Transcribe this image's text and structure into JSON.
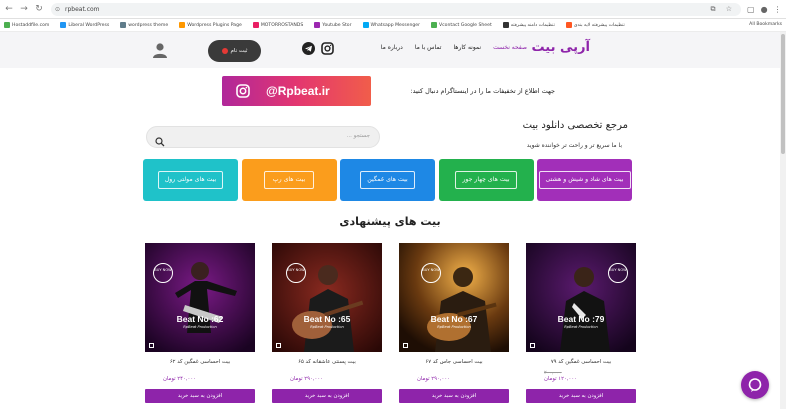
{
  "browser": {
    "url": "rpbeat.com",
    "bookmarks": [
      "Hostaddfile.com",
      "Liberal WordPress",
      "wordpress theme",
      "Wordpress Plugins Page",
      "MOTORROSTANDS",
      "Youtube Stor",
      "Whatsapp Messenger",
      "Vcontact Google Sheet",
      "تنظیمات دامنه پیشرفته",
      "تنظیمات پیشرفته لایه بندی",
      "All Bookmarks"
    ],
    "bookmark_colors": [
      "#4caf50",
      "#2196f3",
      "#607d8b",
      "#ff9800",
      "#e91e63",
      "#9c27b0",
      "#03a9f4",
      "#4caf50",
      "#333333",
      "#ff5722"
    ]
  },
  "header": {
    "logo": "آرپی بیت",
    "menu": [
      "صفحه نخست",
      "نمونه کارها",
      "تماس با ما",
      "درباره ما"
    ],
    "login_label": "ثبت نام",
    "accent": "#8e24aa"
  },
  "instagram": {
    "handle": "@Rpbeat.ir",
    "text": "جهت اطلاع از تخفیفات ما را در اینستاگرام دنبال کنید:"
  },
  "hero": {
    "title": "مرجع تخصصی دانلود بیت",
    "subtitle": "با ما سریع تر و راحت تر خواننده شوید",
    "search_placeholder": "جستجو ..."
  },
  "categories": [
    {
      "label": "بیت های شاد و شیش و هشتی",
      "color": "#a22fb9"
    },
    {
      "label": "بیت های چهار جور",
      "color": "#23b14d"
    },
    {
      "label": "بیت های غمگین",
      "color": "#1e88e5"
    },
    {
      "label": "بیت های رپ",
      "color": "#fb9d1c"
    },
    {
      "label": "بیت های مولتی رول",
      "color": "#1fc2c9"
    }
  ],
  "section_title": "بیت های پیشنهادی",
  "products": [
    {
      "beat": "Beat No :79",
      "sub": "RpBeat Production",
      "name": "بیت احساسی غمگین کد ۷۹",
      "old_price": "۲۰۰,۰۰۰",
      "price": "۱۲۰,۰۰۰ تومان",
      "buy": "افزودن به سبد خرید"
    },
    {
      "beat": "Beat No :67",
      "sub": "RpBeat Production",
      "name": "بیت احساسی جاس کد ۶۷",
      "old_price": "",
      "price": "۲۹۰,۰۰۰ تومان",
      "buy": "افزودن به سبد خرید"
    },
    {
      "beat": "Beat No :65",
      "sub": "RpBeat Production",
      "name": "بیت پسنتی عاشقانه کد ۶۵",
      "old_price": "",
      "price": "۲۹۰,۰۰۰ تومان",
      "buy": "افزودن به سبد خرید"
    },
    {
      "beat": "Beat No :62",
      "sub": "RpBeat Production",
      "name": "بیت احساسی غمگین کد ۶۲",
      "old_price": "",
      "price": "۲۴۰,۰۰۰ تومان",
      "buy": "افزودن به سبد خرید"
    }
  ],
  "buy_now": "BUY NOW"
}
